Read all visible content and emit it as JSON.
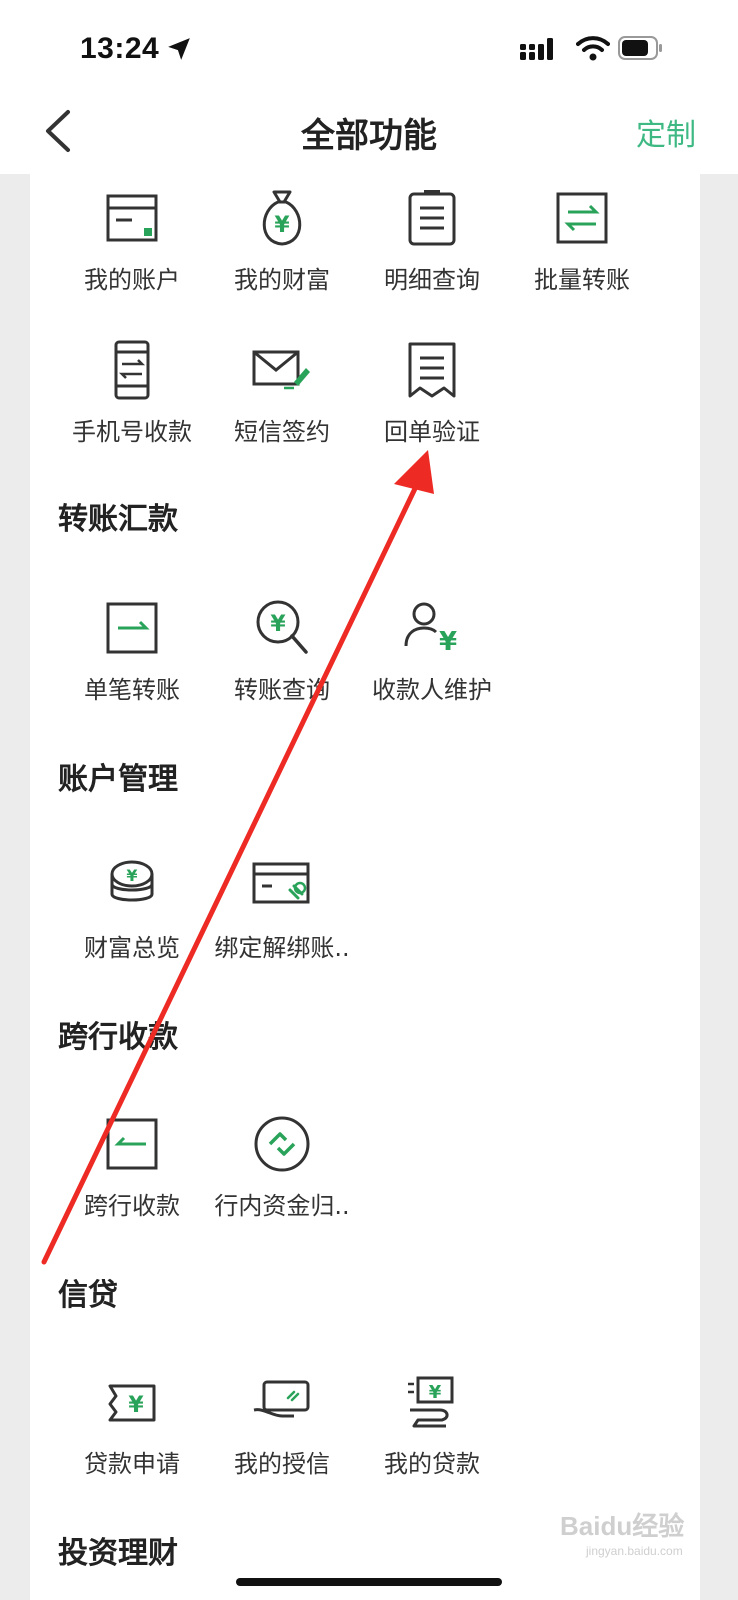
{
  "status_bar": {
    "time": "13:24"
  },
  "nav": {
    "title": "全部功能",
    "customize_label": "定制"
  },
  "top_group": [
    {
      "label": "我的账户",
      "icon": "account-card-icon"
    },
    {
      "label": "我的财富",
      "icon": "money-bag-icon"
    },
    {
      "label": "明细查询",
      "icon": "clipboard-list-icon"
    },
    {
      "label": "批量转账",
      "icon": "transfer-arrows-icon"
    },
    {
      "label": "手机号收款",
      "icon": "phone-transfer-icon"
    },
    {
      "label": "短信签约",
      "icon": "sms-envelope-icon"
    },
    {
      "label": "回单验证",
      "icon": "receipt-icon"
    }
  ],
  "sections": [
    {
      "title": "转账汇款",
      "items": [
        {
          "label": "单笔转账",
          "icon": "single-transfer-icon"
        },
        {
          "label": "转账查询",
          "icon": "search-yuan-icon"
        },
        {
          "label": "收款人维护",
          "icon": "payee-icon"
        }
      ]
    },
    {
      "title": "账户管理",
      "items": [
        {
          "label": "财富总览",
          "icon": "coins-stack-icon"
        },
        {
          "label": "绑定解绑账..",
          "icon": "card-link-icon"
        }
      ]
    },
    {
      "title": "跨行收款",
      "items": [
        {
          "label": "跨行收款",
          "icon": "interbank-receive-icon"
        },
        {
          "label": "行内资金归..",
          "icon": "fund-collection-icon"
        }
      ]
    },
    {
      "title": "信贷",
      "items": [
        {
          "label": "贷款申请",
          "icon": "loan-apply-icon"
        },
        {
          "label": "我的授信",
          "icon": "credit-hand-icon"
        },
        {
          "label": "我的贷款",
          "icon": "my-loan-icon"
        }
      ]
    },
    {
      "title": "投资理财",
      "items": []
    }
  ],
  "watermark": {
    "brand": "Baidu经验",
    "url": "jingyan.baidu.com"
  },
  "colors": {
    "accent": "#3fb984",
    "icon_green": "#2aa35a",
    "annotation_arrow": "#ee2a24"
  }
}
